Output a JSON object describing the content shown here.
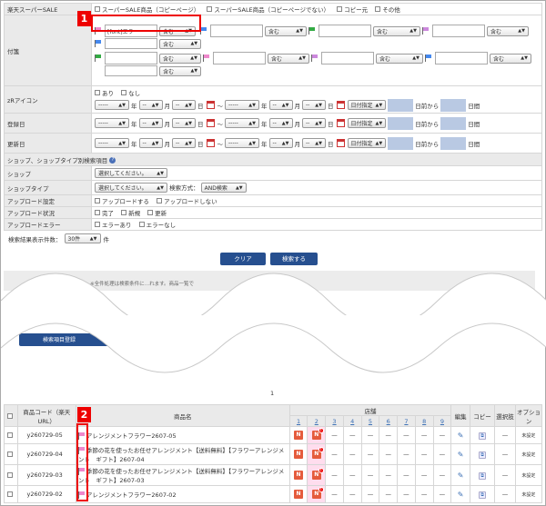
{
  "colors": {
    "accent": "#264f8f",
    "highlight": "#e00000",
    "flag_pink": "#ee88cc",
    "flag_blue": "#4488ee",
    "flag_green": "#33aa44",
    "flag_purple": "#cc88dd"
  },
  "form": {
    "sale_label": "楽天スーパーSALE",
    "sale_opts": [
      "スーパーSALE商品（コピーページ）",
      "スーパーSALE商品（コピーページでない）",
      "コピー元",
      "その他"
    ],
    "tag_label": "付箋",
    "tag_row1": {
      "text1": "[font]エラー",
      "ops": [
        "含む",
        "含む",
        "含む",
        "含む"
      ],
      "op_last": "含む"
    },
    "tag_row2": {
      "ops": [
        "含む",
        "含む",
        "含む",
        "含む"
      ]
    },
    "tag_row2_last": "含む",
    "zr_label": "zRアイコン",
    "zr_opts": [
      "あり",
      "なし"
    ],
    "date_sel": "-----",
    "date_dash": "--",
    "nen": "年",
    "tsuki": "月",
    "hi": "日",
    "tilde": "〜",
    "date_btn": "日付指定",
    "before_from": "日前から",
    "days": "日間",
    "reg_label": "登録日",
    "upd_label": "更新日",
    "shop_section": "ショップ、ショップタイプ別検索項目",
    "help": "?",
    "shop_label": "ショップ",
    "shop_sel": "選択してください。",
    "shoptype_label": "ショップタイプ",
    "shoptype_sel": "選択してください。",
    "search_method": "検索方式：",
    "search_method_val": "AND検索",
    "upload_setting_label": "アップロード設定",
    "upload_setting_opts": [
      "アップロードする",
      "アップロードしない"
    ],
    "upload_status_label": "アップロード状況",
    "upload_status_opts": [
      "完了",
      "新規",
      "更新"
    ],
    "upload_error_label": "アップロードエラー",
    "upload_error_opts": [
      "エラーあり",
      "エラーなし"
    ]
  },
  "results_count_label": "検索結果表示件数：",
  "results_count_val": "30件",
  "results_count_unit": "件",
  "clear_btn": "クリア",
  "search_btn": "検索する",
  "notice_text": "※全件処理は検索条件に…れます。商品一覧で",
  "bulk_btn": "検索項目登録",
  "callout1": "1",
  "callout2": "2",
  "page_num": "1",
  "list": {
    "h_code": "商品コード（楽天URL）",
    "h_name": "商品名",
    "h_shops": "店舗",
    "h_edit": "編集",
    "h_copy": "コピー",
    "h_select": "選択肢",
    "h_option": "オプション",
    "shop_nums": [
      "1",
      "2",
      "3",
      "4",
      "5",
      "6",
      "7",
      "8",
      "9"
    ],
    "n_label": "N",
    "dash": "—",
    "unset": "未設定",
    "rows": [
      {
        "code": "y260729-05",
        "name": "アレンジメントフラワー2607-05"
      },
      {
        "code": "y260729-04",
        "name": "季節の花を使ったお任せアレンジメント【送料無料】【フラワーアレンジメント　ギフト】2607-04"
      },
      {
        "code": "y260729-03",
        "name": "季節の花を使ったお任せアレンジメント【送料無料】【フラワーアレンジメント　ギフト】2607-03"
      },
      {
        "code": "y260729-02",
        "name": "アレンジメントフラワー2607-02"
      }
    ]
  }
}
